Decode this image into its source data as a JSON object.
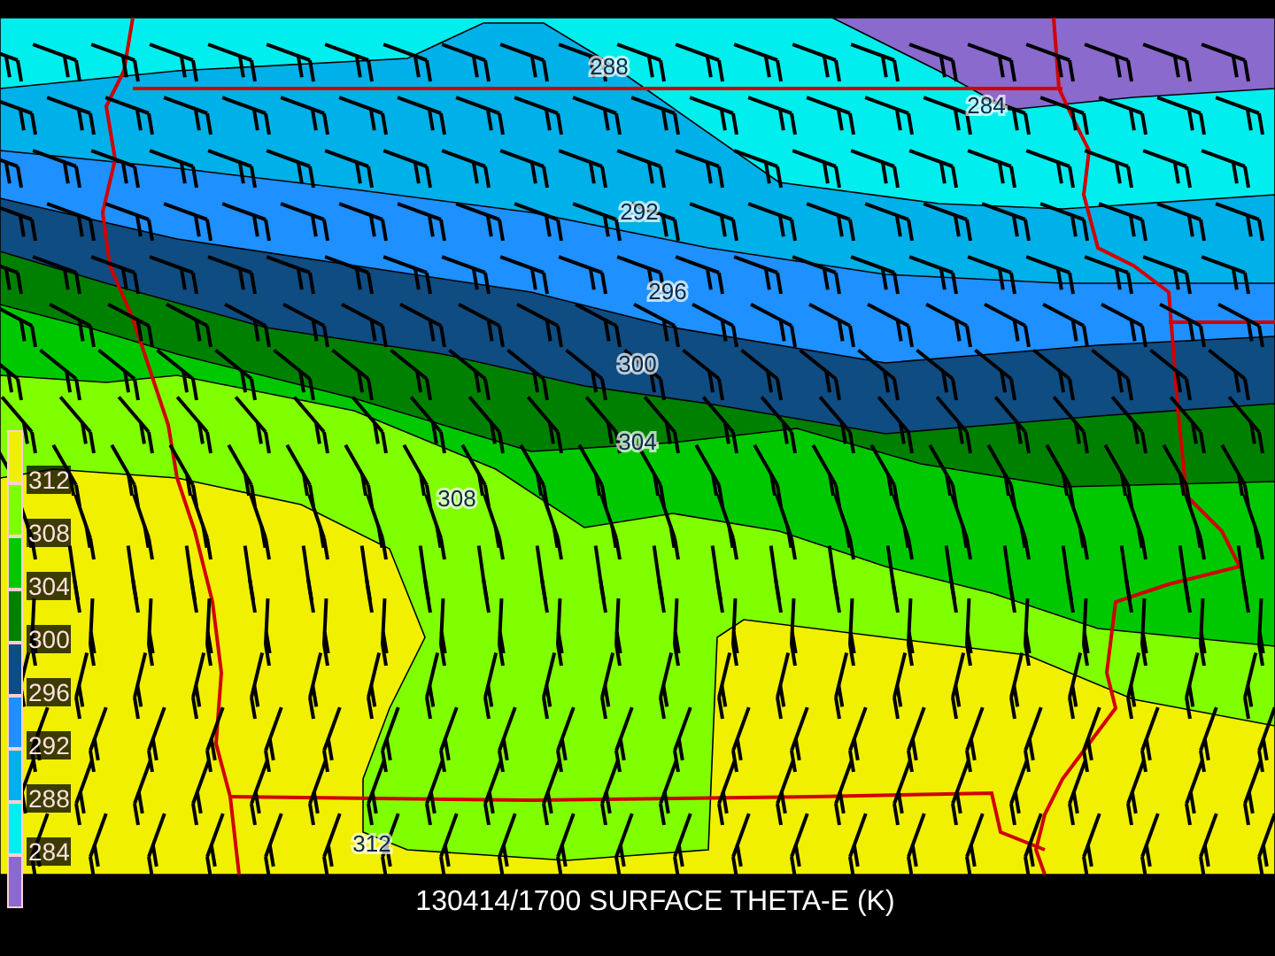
{
  "map": {
    "contour_labels": [
      {
        "text": "288"
      },
      {
        "text": "284"
      },
      {
        "text": "292"
      },
      {
        "text": "296"
      },
      {
        "text": "300"
      },
      {
        "text": "304"
      },
      {
        "text": "308"
      },
      {
        "text": "312"
      }
    ]
  },
  "legend": {
    "items": [
      {
        "label": "312",
        "color": "#f0f000"
      },
      {
        "label": "308",
        "color": "#80ff00"
      },
      {
        "label": "304",
        "color": "#00c800"
      },
      {
        "label": "300",
        "color": "#008000"
      },
      {
        "label": "296",
        "color": "#0f4c81"
      },
      {
        "label": "292",
        "color": "#1e90ff"
      },
      {
        "label": "288",
        "color": "#00b0e8"
      },
      {
        "label": "284",
        "color": "#00eeee"
      },
      {
        "color": "#8a6acc"
      }
    ]
  },
  "caption": "130414/1700 SURFACE THETA-E (K)"
}
